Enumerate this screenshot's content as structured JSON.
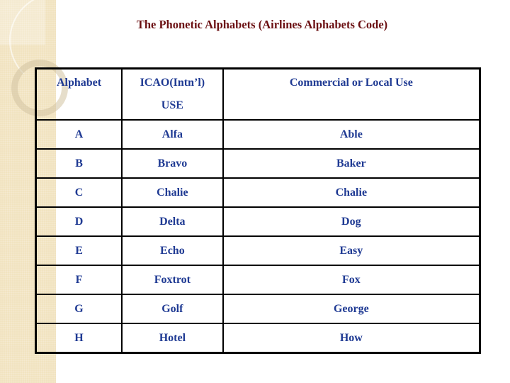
{
  "title": "The Phonetic Alphabets (Airlines Alphabets Code)",
  "colors": {
    "title": "#6b0f12",
    "table_text": "#1f3a93",
    "sidebar": "#f1e3c0"
  },
  "table": {
    "headers": {
      "alphabet": "Alphabet",
      "icao_line1": "ICAO(Intn’l)",
      "icao_line2": "USE",
      "commercial": "Commercial  or Local Use"
    },
    "rows": [
      {
        "letter": "A",
        "icao": "Alfa",
        "commercial": "Able"
      },
      {
        "letter": "B",
        "icao": "Bravo",
        "commercial": "Baker"
      },
      {
        "letter": "C",
        "icao": "Chalie",
        "commercial": "Chalie"
      },
      {
        "letter": "D",
        "icao": "Delta",
        "commercial": "Dog"
      },
      {
        "letter": "E",
        "icao": "Echo",
        "commercial": "Easy"
      },
      {
        "letter": "F",
        "icao": "Foxtrot",
        "commercial": "Fox"
      },
      {
        "letter": "G",
        "icao": "Golf",
        "commercial": "George"
      },
      {
        "letter": "H",
        "icao": "Hotel",
        "commercial": "How"
      }
    ]
  }
}
